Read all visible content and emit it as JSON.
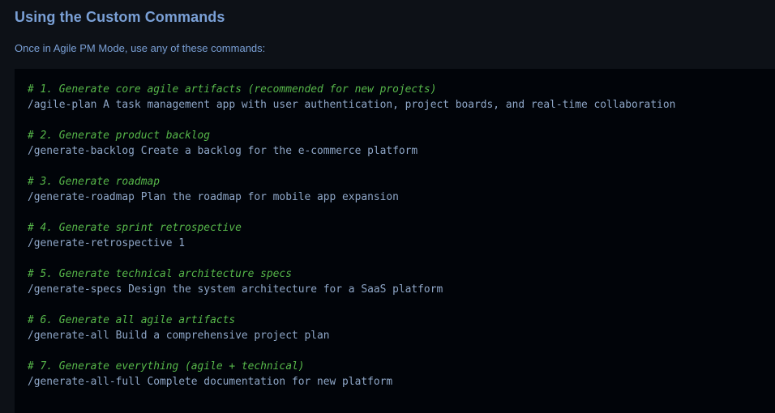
{
  "section": {
    "title": "Using the Custom Commands",
    "intro": "Once in Agile PM Mode, use any of these commands:"
  },
  "commands": [
    {
      "comment": "# 1. Generate core agile artifacts (recommended for new projects)",
      "command": "/agile-plan A task management app with user authentication, project boards, and real-time collaboration"
    },
    {
      "comment": "# 2. Generate product backlog",
      "command": "/generate-backlog Create a backlog for the e-commerce platform"
    },
    {
      "comment": "# 3. Generate roadmap",
      "command": "/generate-roadmap Plan the roadmap for mobile app expansion"
    },
    {
      "comment": "# 4. Generate sprint retrospective",
      "command": "/generate-retrospective 1"
    },
    {
      "comment": "# 5. Generate technical architecture specs",
      "command": "/generate-specs Design the system architecture for a SaaS platform"
    },
    {
      "comment": "# 6. Generate all agile artifacts",
      "command": "/generate-all Build a comprehensive project plan"
    },
    {
      "comment": "# 7. Generate everything (agile + technical)",
      "command": "/generate-all-full Complete documentation for new platform"
    }
  ],
  "colors": {
    "background": "#0d1117",
    "code_background": "#010409",
    "heading": "#7aa0d6",
    "comment": "#57b84a",
    "command": "#8fa7c8"
  }
}
